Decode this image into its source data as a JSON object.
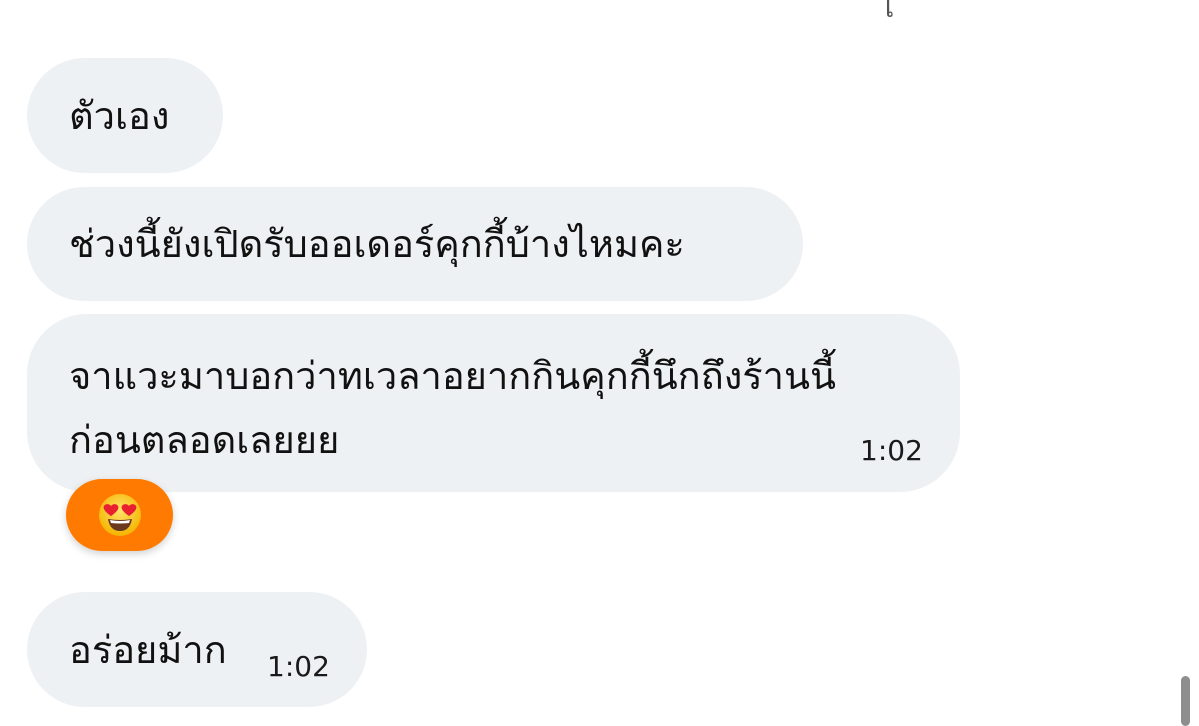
{
  "messages": [
    {
      "text": "ตัวเอง"
    },
    {
      "text": "ช่วงนี้ยังเปิดรับออเดอร์คุกกี้บ้างไหมคะ"
    },
    {
      "lines": [
        "จาแวะมาบอกว่าทเวลาอยากกินคุกกี้นึกถึงร้านนี้",
        "ก่อนตลอดเลยยย"
      ],
      "time": "1:02",
      "reaction": {
        "icon": "heart-eyes-emoji-icon",
        "color": "#ff7a00"
      }
    },
    {
      "text": "อร่อยม้าก",
      "time": "1:02"
    }
  ],
  "colors": {
    "bubble": "#eef1f3",
    "background": "#ffffff",
    "reaction_badge": "#ff7a00"
  }
}
